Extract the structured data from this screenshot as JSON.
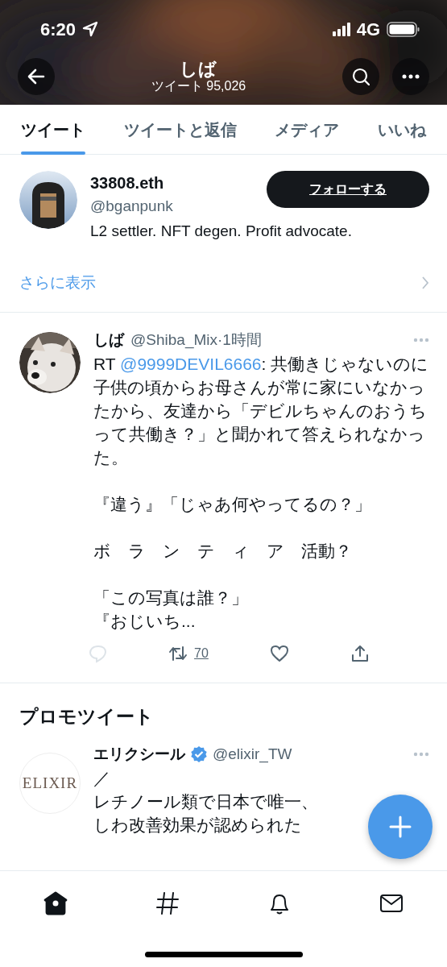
{
  "status_bar": {
    "time": "6:20",
    "network": "4G"
  },
  "header": {
    "title": "しば",
    "subtitle": "ツイート 95,026"
  },
  "tabs": [
    {
      "label": "ツイート",
      "selected": true
    },
    {
      "label": "ツイートと返信",
      "selected": false
    },
    {
      "label": "メディア",
      "selected": false
    },
    {
      "label": "いいね",
      "selected": false
    }
  ],
  "suggested_user": {
    "name": "33808.eth",
    "handle": "@bganpunk",
    "follow_button": "フォローする",
    "bio": "L2 settler. NFT degen. Profit advocate.",
    "more_link": "さらに表示"
  },
  "tweet": {
    "name": "しば",
    "handle": "@Shiba_Mix",
    "separator": "·",
    "time": "1時間",
    "prefix": "RT ",
    "mention": "@9999DEVIL6666",
    "body": ": 共働きじゃないのに子供の頃からお母さんが常に家にいなかったから、友達から「デビルちゃんのおうちって共働き？」と聞かれて答えられなかった。",
    "paragraphs": [
      [
        "『違う』「じゃあ何やってるの？」"
      ],
      [
        "ボ　ラ　ン　テ　ィ　ア　活動？"
      ],
      [
        "「この写真は誰？」",
        "『おじいち..."
      ]
    ],
    "retweets": "70",
    "liked": false
  },
  "promo": {
    "heading": "プロモツイート",
    "name": "エリクシール",
    "verified": true,
    "handle": "@elixir_TW",
    "logo": "ELIXIR",
    "lines": [
      "／",
      "レチノール類で日本で唯一、",
      "しわ改善効果が認められた"
    ]
  },
  "bottom_nav": [
    {
      "kind": "home",
      "selected": true
    },
    {
      "kind": "explore",
      "selected": false
    },
    {
      "kind": "notifications",
      "selected": false
    },
    {
      "kind": "messages",
      "selected": false
    }
  ]
}
